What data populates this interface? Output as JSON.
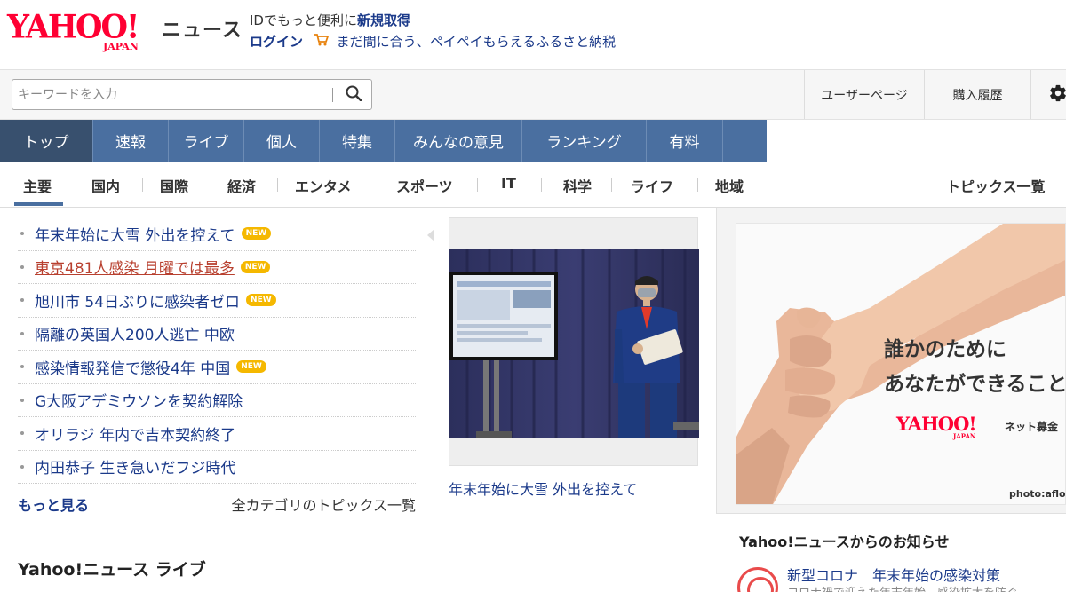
{
  "header": {
    "logo_text": "YAHOO!",
    "logo_sub": "JAPAN",
    "service_name": "ニュース",
    "promo_text": "IDでもっと便利に",
    "promo_link": "新規取得",
    "login_label": "ログイン",
    "cart_icon": "cart-icon",
    "campaign_text": "まだ間に合う、ペイペイもらえるふるさと納税"
  },
  "search": {
    "placeholder": "キーワードを入力",
    "icon": "search-icon"
  },
  "user_links": {
    "user_page": "ユーザーページ",
    "purchase_history": "購入履歴",
    "settings_icon": "gear-icon"
  },
  "main_nav": [
    {
      "label": "トップ",
      "active": true
    },
    {
      "label": "速報"
    },
    {
      "label": "ライブ"
    },
    {
      "label": "個人"
    },
    {
      "label": "特集"
    },
    {
      "label": "みんなの意見"
    },
    {
      "label": "ランキング"
    },
    {
      "label": "有料"
    }
  ],
  "sub_nav": {
    "categories": [
      "主要",
      "国内",
      "国際",
      "経済",
      "エンタメ",
      "スポーツ",
      "IT",
      "科学",
      "ライフ",
      "地域"
    ],
    "topics_link": "トピックス一覧"
  },
  "headlines": [
    {
      "title": "年末年始に大雪 外出を控えて",
      "new": true
    },
    {
      "title": "東京481人感染 月曜では最多",
      "new": true,
      "visited": true
    },
    {
      "title": "旭川市 54日ぶりに感染者ゼロ",
      "new": true
    },
    {
      "title": "隔離の英国人200人逃亡 中欧",
      "new": false
    },
    {
      "title": "感染情報発信で懲役4年 中国",
      "new": true
    },
    {
      "title": "G大阪アデミウソンを契約解除",
      "new": false
    },
    {
      "title": "オリラジ 年内で吉本契約終了",
      "new": false
    },
    {
      "title": "内田恭子 生き急いだフジ時代",
      "new": false
    }
  ],
  "new_badge": "NEW",
  "more_link": "もっと見る",
  "all_categories_link": "全カテゴリのトピックス一覧",
  "pickup": {
    "caption": "年末年始に大雪 外出を控えて"
  },
  "live_section_title": "Yahoo!ニュース ライブ",
  "ad": {
    "line1": "誰かのために",
    "line2": "あなたができること",
    "logo_text": "YAHOO!",
    "logo_sub": "JAPAN",
    "brand": "ネット募金",
    "credit": "photo:aflo"
  },
  "notice": {
    "title": "Yahoo!ニュースからのお知らせ",
    "link": "新型コロナ　年末年始の感染対策",
    "sub": "コロナ禍で迎えた年末年始、感染拡大を防ぐ"
  }
}
